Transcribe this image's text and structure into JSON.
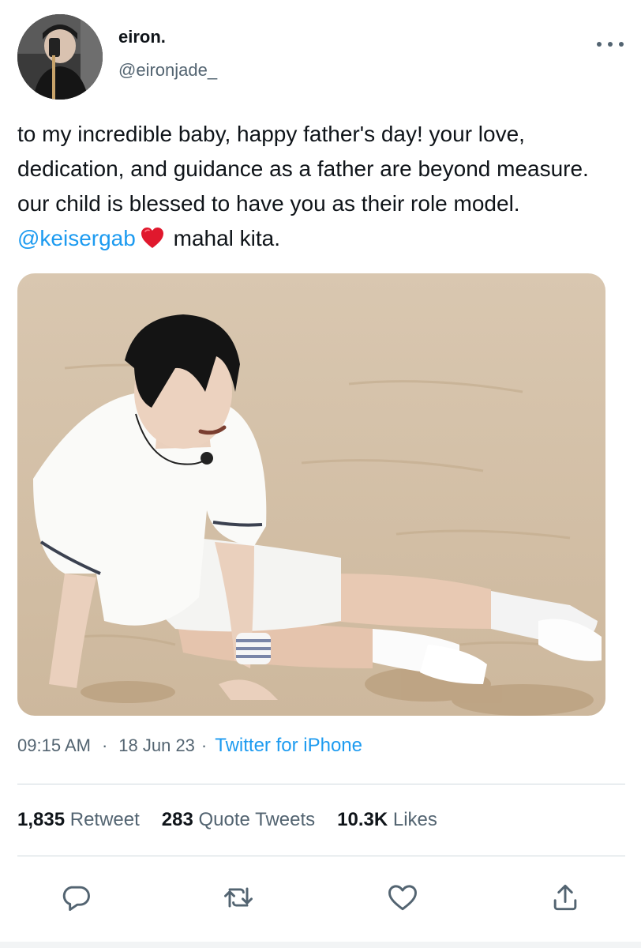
{
  "user": {
    "display_name": "eiron.",
    "handle": "@eironjade_"
  },
  "tweet": {
    "text_before_mention": "to my incredible baby, happy father's day! your love, dedication, and guidance as a father are beyond measure. our child is blessed to have you as their role model. ",
    "mention": "@keisergab",
    "text_after_mention": " mahal kita."
  },
  "meta": {
    "time": "09:15 AM",
    "separator1": "·",
    "date": "18 Jun 23",
    "separator2": "·",
    "source": "Twitter for iPhone"
  },
  "stats": {
    "retweets_count": "1,835",
    "retweets_label": "Retweet",
    "quotes_count": "283",
    "quotes_label": "Quote Tweets",
    "likes_count": "10.3K",
    "likes_label": "Likes"
  },
  "icons": {
    "more": "more-horizontal-icon",
    "reply": "reply-icon",
    "retweet": "retweet-icon",
    "like": "heart-icon",
    "share": "share-icon",
    "emoji": "red-heart-emoji"
  },
  "colors": {
    "link": "#1d9bf0",
    "secondary_text": "#536471",
    "primary_text": "#0f1419",
    "divider": "#cfd9de",
    "emoji_heart": "#e0182d"
  }
}
